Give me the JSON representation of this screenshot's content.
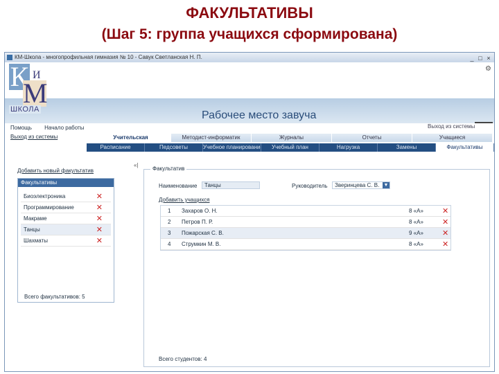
{
  "slide": {
    "title": "ФАКУЛЬТАТИВЫ",
    "subtitle": "(Шаг 5: группа учащихся сформирована)"
  },
  "window": {
    "title": "КМ-Школа - многопрофильная гимназия № 10 - Савук Светланская Н. П.",
    "controls": [
      "_",
      "□",
      "×"
    ]
  },
  "logo": {
    "k": "К",
    "m": "М",
    "i": "И",
    "school": "ШКОЛА"
  },
  "header": {
    "workplace": "Рабочее место завуча",
    "exit_link": "Выход из системы",
    "nav": [
      "Помощь",
      "Начало работы"
    ],
    "back_link": "Выход из системы"
  },
  "tabs_primary": [
    "Учительская",
    "Методист-информатик",
    "Журналы",
    "Отчеты",
    "Учащиеся"
  ],
  "tabs_primary_active": "Учительская",
  "tabs_secondary": [
    "Расписание",
    "Педсоветы",
    "Учебное планирование",
    "Учебный план",
    "Нагрузка",
    "Замены",
    "Факультативы"
  ],
  "tabs_secondary_active": "Факультативы",
  "left": {
    "add_link": "Добавить новый факультатив",
    "panel_title": "Факультативы",
    "items": [
      "Биоэлектроника",
      "Программирование",
      "Макраме",
      "Танцы",
      "Шахматы"
    ],
    "selected": "Танцы",
    "total": "Всего факультативов: 5"
  },
  "detail": {
    "group_label": "Факультатив",
    "name_label": "Наименование",
    "name_value": "Танцы",
    "leader_label": "Руководитель",
    "leader_value": "Зверинцева С. В.",
    "add_student": "Добавить учащихся",
    "students": [
      {
        "num": "1",
        "name": "Захаров О. Н.",
        "class": "8 «А»"
      },
      {
        "num": "2",
        "name": "Петров П. Р.",
        "class": "8 «А»"
      },
      {
        "num": "3",
        "name": "Пожарская С. В.",
        "class": "9 «А»"
      },
      {
        "num": "4",
        "name": "Струмкин М. В.",
        "class": "8 «А»"
      }
    ],
    "total": "Всего студентов: 4"
  },
  "icons": {
    "delete": "delete-x-icon"
  },
  "colors": {
    "title": "#8b0a10",
    "header_band": "#b7cde3",
    "tab_dark": "#234e82",
    "delete": "#cc2222"
  }
}
